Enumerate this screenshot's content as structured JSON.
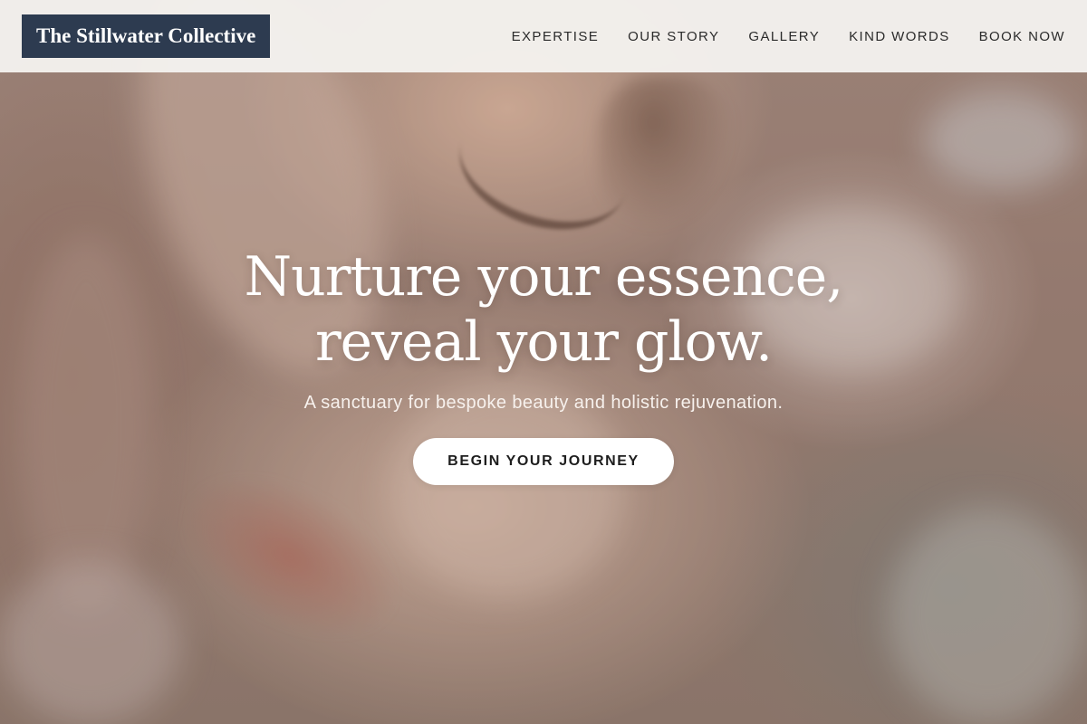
{
  "header": {
    "logo_text": "The Stillwater Collective",
    "nav": [
      {
        "label": "EXPERTISE"
      },
      {
        "label": "OUR STORY"
      },
      {
        "label": "GALLERY"
      },
      {
        "label": "KIND WORDS"
      },
      {
        "label": "BOOK NOW"
      }
    ]
  },
  "hero": {
    "headline_line1": "Nurture your essence,",
    "headline_line2": "reveal your glow.",
    "subtitle": "A sanctuary for bespoke beauty and holistic rejuvenation.",
    "cta_label": "BEGIN YOUR JOURNEY"
  },
  "colors": {
    "logo_background": "#2d3b50",
    "header_background": "#f4f1ee",
    "cta_background": "#ffffff"
  }
}
